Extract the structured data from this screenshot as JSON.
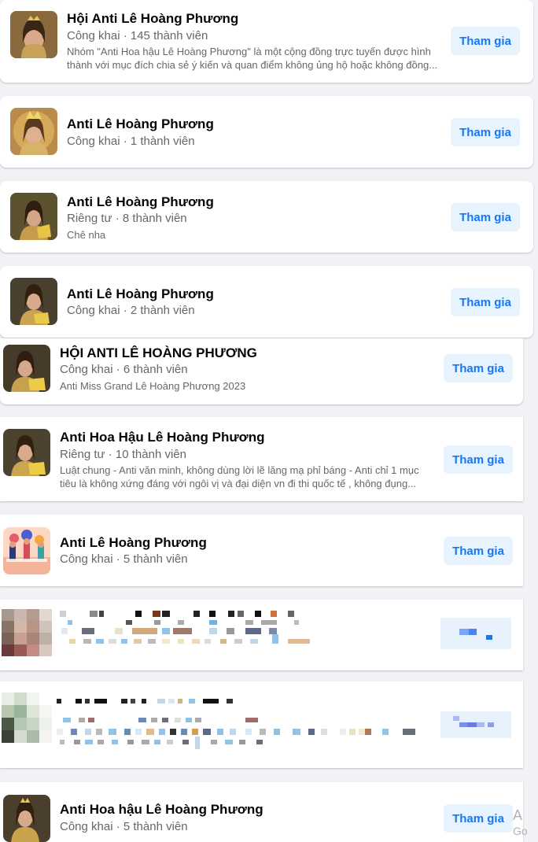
{
  "colors": {
    "page_bg": "#f0f2f5",
    "card_bg": "#ffffff",
    "join_bg": "#e7f3ff",
    "join_text": "#1877f2",
    "meta_text": "#65676b"
  },
  "join_label": "Tham gia",
  "groups": [
    {
      "title": "Hội Anti Lê Hoàng Phương",
      "meta": "Công khai · 145 thành viên",
      "desc_line1": "Nhóm \"Anti Hoa hậu Lê Hoàng Phương\" là một cộng đồng trực tuyến được hình",
      "desc_line2": "thành với mục đích chia sẻ ý kiến và quan điểm không ủng hộ hoặc không đồng..."
    },
    {
      "title": "Anti Lê Hoàng Phương",
      "meta": "Công khai · 1 thành viên"
    },
    {
      "title": "Anti Lê Hoàng Phương",
      "meta": "Riêng tư · 8 thành viên",
      "desc": "Chê nha"
    },
    {
      "title": "Anti Lê Hoàng Phương",
      "meta": "Công khai · 2 thành viên"
    },
    {
      "title": "HỘI ANTI LÊ HOÀNG PHƯƠNG",
      "meta": "Công khai · 6 thành viên",
      "desc": "Anti Miss Grand Lê Hoàng Phương 2023"
    },
    {
      "title": "Anti Hoa Hậu Lê Hoàng Phương",
      "meta": "Riêng tư · 10 thành viên",
      "desc_line1": "Luật chung - Anti văn minh, không dùng lời lẽ lăng mạ phỉ báng - Anti chỉ 1 mục",
      "desc_line2": "tiêu là không xứng đáng với ngôi vị và đại diện vn đi thi quốc tế , không đụng..."
    },
    {
      "title": "Anti Lê Hoàng Phương",
      "meta": "Công khai · 5 thành viên"
    },
    {
      "title": "Anti Hoa hậu Lê Hoàng Phương",
      "meta": "Công khai · 5 thành viên"
    }
  ],
  "edge": {
    "char1": "A",
    "char2": "Go"
  }
}
